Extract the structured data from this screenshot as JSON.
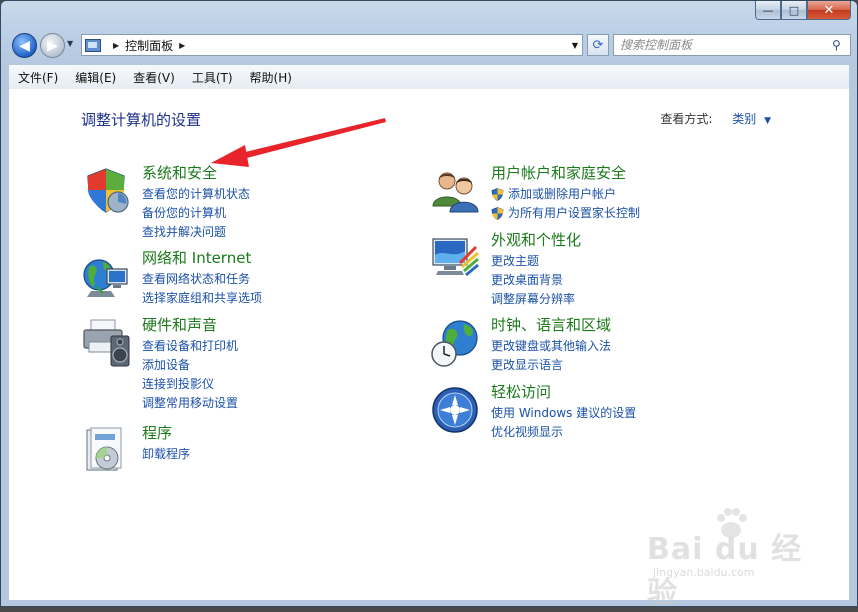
{
  "window": {
    "caption": {
      "minimize": "—",
      "maximize": "□",
      "close": "✕"
    }
  },
  "navbar": {
    "address_path": "控制面板",
    "search_placeholder": "搜索控制面板"
  },
  "menu": [
    "文件(F)",
    "编辑(E)",
    "查看(V)",
    "工具(T)",
    "帮助(H)"
  ],
  "content": {
    "page_title": "调整计算机的设置",
    "view_by_label": "查看方式:",
    "view_by_value": "类别",
    "categories_left": [
      {
        "title": "系统和安全",
        "icon": "system-security-icon",
        "links": [
          "查看您的计算机状态",
          "备份您的计算机",
          "查找并解决问题"
        ]
      },
      {
        "title": "网络和 Internet",
        "icon": "network-icon",
        "links": [
          "查看网络状态和任务",
          "选择家庭组和共享选项"
        ]
      },
      {
        "title": "硬件和声音",
        "icon": "hardware-sound-icon",
        "links": [
          "查看设备和打印机",
          "添加设备",
          "连接到投影仪",
          "调整常用移动设置"
        ]
      },
      {
        "title": "程序",
        "icon": "programs-icon",
        "links": [
          "卸载程序"
        ]
      }
    ],
    "categories_right": [
      {
        "title": "用户帐户和家庭安全",
        "icon": "user-accounts-icon",
        "links": [
          "添加或删除用户帐户",
          "为所有用户设置家长控制"
        ]
      },
      {
        "title": "外观和个性化",
        "icon": "appearance-icon",
        "links": [
          "更改主题",
          "更改桌面背景",
          "调整屏幕分辨率"
        ]
      },
      {
        "title": "时钟、语言和区域",
        "icon": "clock-region-icon",
        "links": [
          "更改键盘或其他输入法",
          "更改显示语言"
        ]
      },
      {
        "title": "轻松访问",
        "icon": "ease-of-access-icon",
        "links": [
          "使用 Windows 建议的设置",
          "优化视频显示"
        ]
      }
    ]
  },
  "watermark": {
    "brand": "Bai du 经验",
    "url": "jingyan.baidu.com"
  }
}
